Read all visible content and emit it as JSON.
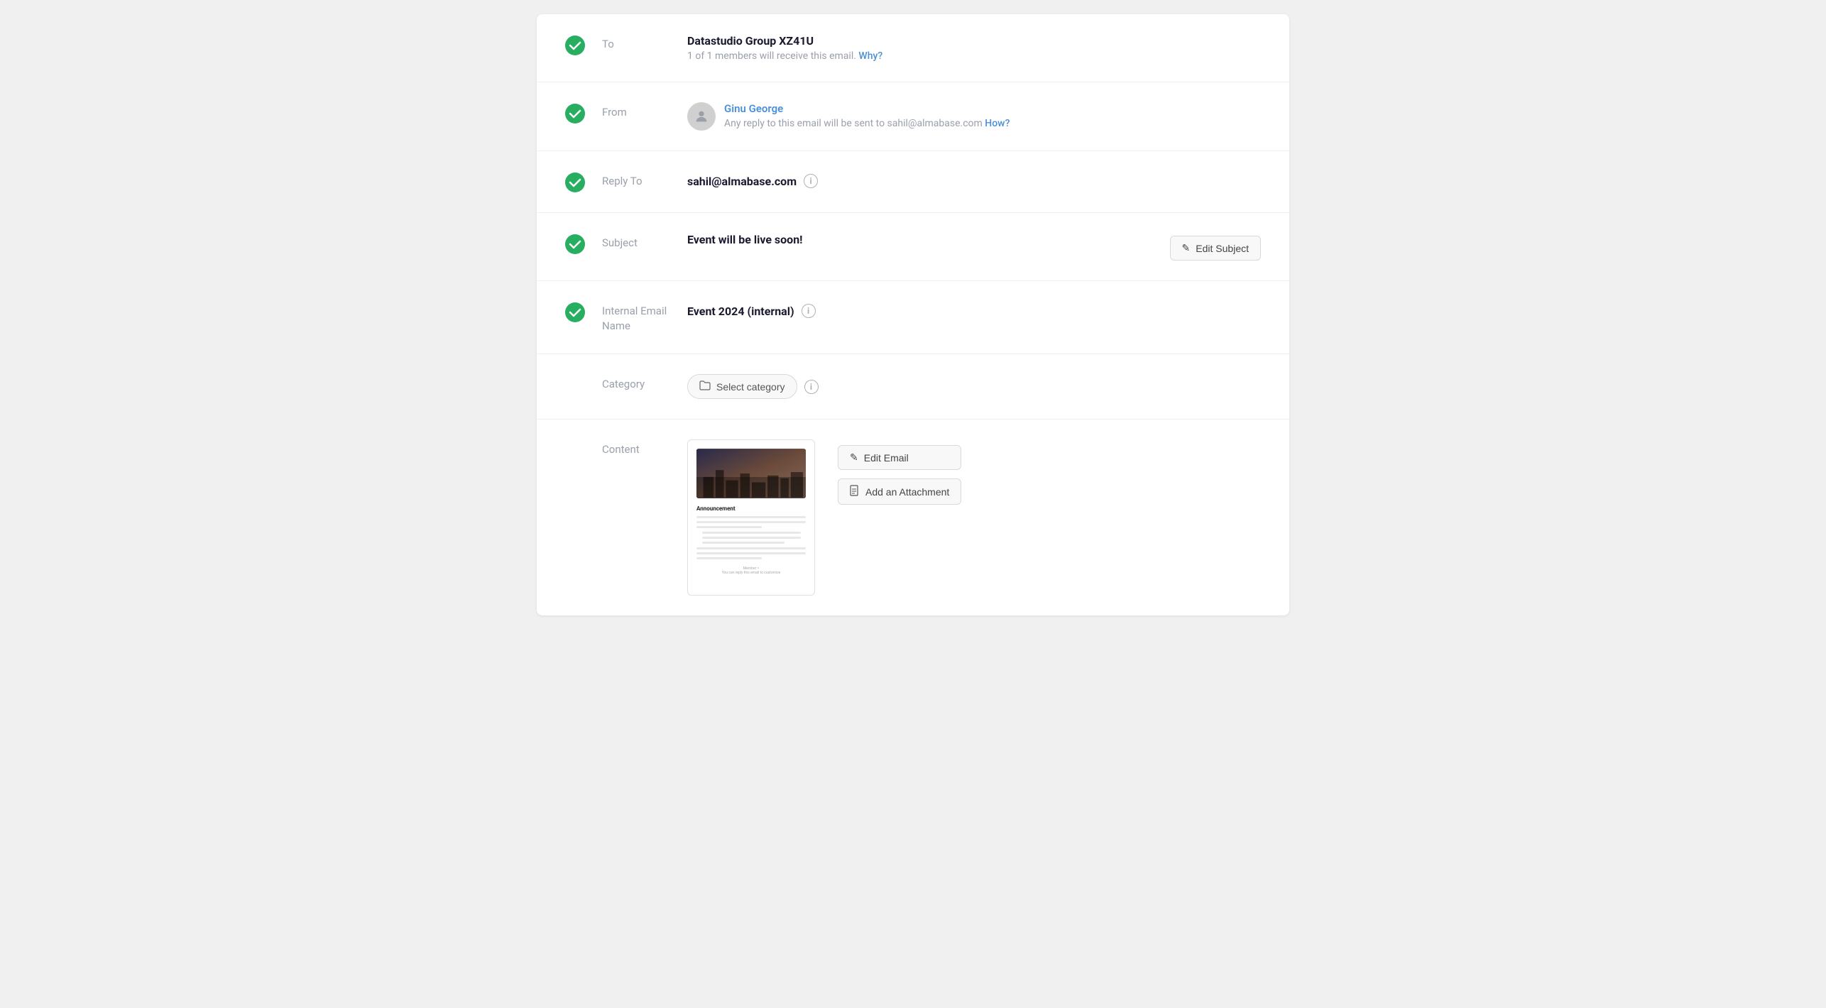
{
  "page": {
    "background": "#f0f0f0"
  },
  "rows": [
    {
      "id": "to",
      "label": "To",
      "hasCheck": true,
      "mainText": "Datastudio Group XZ41U",
      "subText": "1 of 1 members will receive this email.",
      "subLink": "Why?",
      "type": "to"
    },
    {
      "id": "from",
      "label": "From",
      "hasCheck": true,
      "fromName": "Ginu George",
      "subText": "Any reply to this email will be sent to sahil@almabase.com",
      "subLink": "How?",
      "type": "from"
    },
    {
      "id": "reply-to",
      "label": "Reply To",
      "hasCheck": true,
      "email": "sahil@almabase.com",
      "hasArrow": true,
      "type": "reply-to"
    },
    {
      "id": "subject",
      "label": "Subject",
      "hasCheck": true,
      "mainText": "Event will be live soon!",
      "actionLabel": "Edit Subject",
      "type": "subject"
    },
    {
      "id": "internal-email-name",
      "label": "Internal Email Name",
      "hasCheck": true,
      "mainText": "Event 2024 (internal)",
      "type": "internal-name"
    },
    {
      "id": "category",
      "label": "Category",
      "hasCheck": false,
      "categoryLabel": "Select category",
      "type": "category"
    },
    {
      "id": "content",
      "label": "Content",
      "hasCheck": false,
      "editLabel": "Edit Email",
      "attachLabel": "Add an Attachment",
      "previewTitle": "Announcement",
      "type": "content"
    }
  ],
  "icons": {
    "checkmark": "✓",
    "info": "i",
    "folder": "🗁",
    "edit": "✎",
    "attachment": "📄",
    "pencil": "✏"
  }
}
